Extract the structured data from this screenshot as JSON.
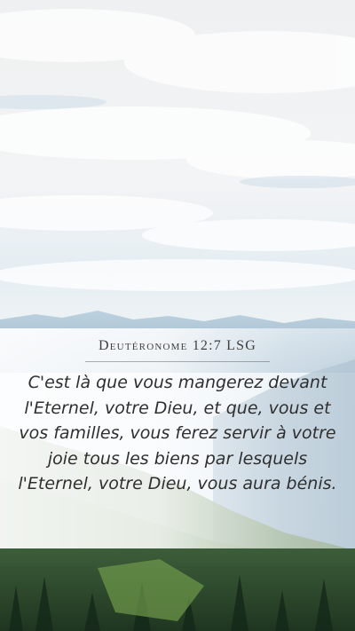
{
  "card": {
    "reference": "Deutéronome 12:7 LSG",
    "verse": "C'est là que vous mangerez devant l'Eternel, votre Dieu, et que, vous et vos familles, vous ferez servir à votre joie tous les biens par lesquels l'Eternel, votre Dieu, vous aura bénis."
  },
  "colors": {
    "sky_top": "#f2f4f5",
    "sky_blue": "#d6e6ef",
    "mountain_blue": "#7fa8c4",
    "forest_green": "#2e4a2c",
    "text": "#2f2f2f"
  }
}
